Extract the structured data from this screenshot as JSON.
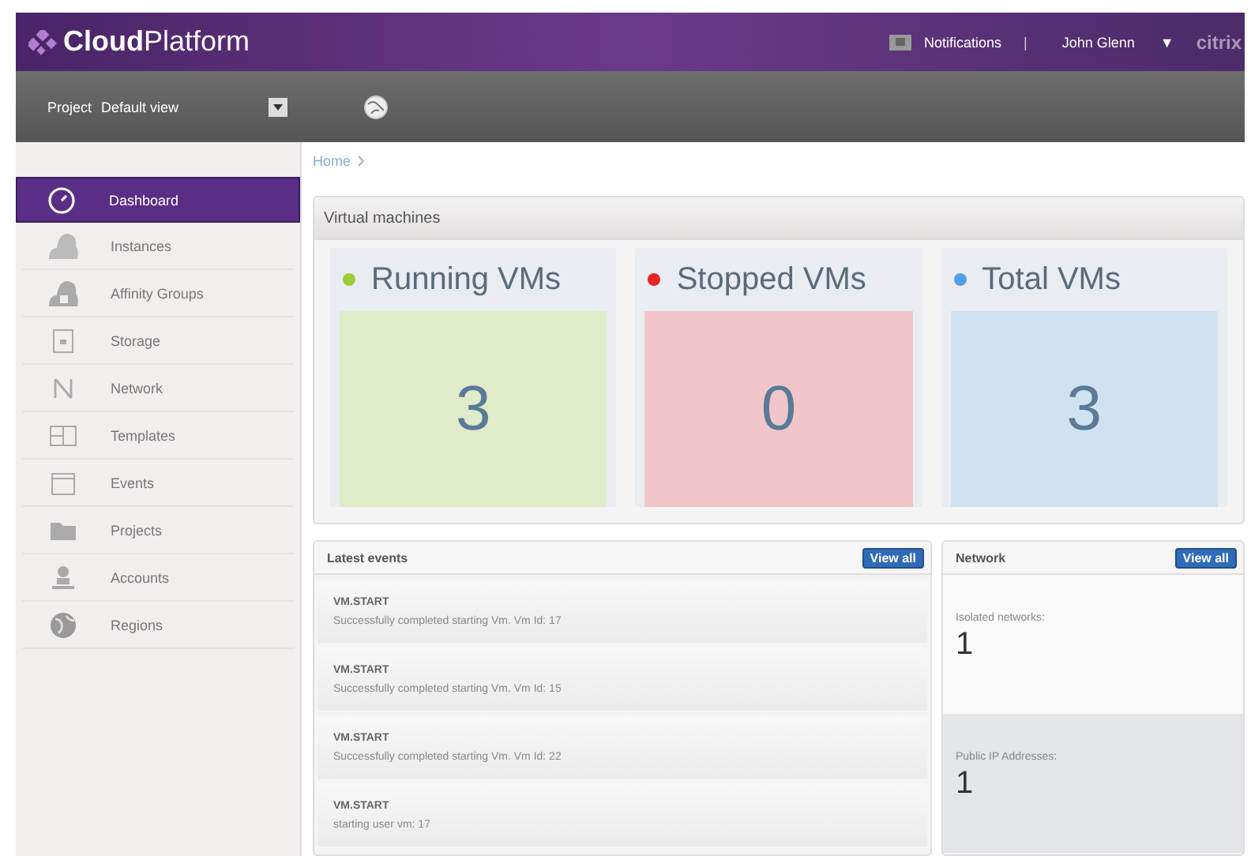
{
  "header": {
    "logo_bold": "Cloud",
    "logo_light": "Platform",
    "notifications": "Notifications",
    "separator": "|",
    "user": "John Glenn",
    "user_caret": "▼",
    "brand": "citrix"
  },
  "toolbar": {
    "project_label": "Project",
    "project_value": "Default view"
  },
  "sidebar": {
    "items": [
      {
        "label": "Dashboard",
        "selected": true
      },
      {
        "label": "Instances",
        "selected": false
      },
      {
        "label": "Affinity Groups",
        "selected": false
      },
      {
        "label": "Storage",
        "selected": false
      },
      {
        "label": "Network",
        "selected": false
      },
      {
        "label": "Templates",
        "selected": false
      },
      {
        "label": "Events",
        "selected": false
      },
      {
        "label": "Projects",
        "selected": false
      },
      {
        "label": "Accounts",
        "selected": false
      },
      {
        "label": "Regions",
        "selected": false
      }
    ]
  },
  "breadcrumb": [
    "Home"
  ],
  "vm_panel": {
    "title": "Virtual machines",
    "cards": [
      {
        "label": "Running VMs",
        "count": "3",
        "color": "#9acd32"
      },
      {
        "label": "Stopped VMs",
        "count": "0",
        "color": "#e8242a"
      },
      {
        "label": "Total VMs",
        "count": "3",
        "color": "#4f9fe8"
      }
    ]
  },
  "events_panel": {
    "title": "Latest events",
    "button": "View all",
    "events": [
      {
        "type": "VM.START",
        "description": "Successfully completed starting Vm. Vm Id: 17"
      },
      {
        "type": "VM.START",
        "description": "Successfully completed starting Vm. Vm Id: 15"
      },
      {
        "type": "VM.START",
        "description": "Successfully completed starting Vm. Vm Id: 22"
      },
      {
        "type": "VM.START",
        "description": "starting user vm: 17"
      }
    ]
  },
  "network_panel": {
    "title": "Network",
    "button": "View all",
    "stats": [
      {
        "label": "Isolated networks:",
        "value": "1"
      },
      {
        "label": "Public IP Addresses:",
        "value": "1"
      }
    ]
  }
}
